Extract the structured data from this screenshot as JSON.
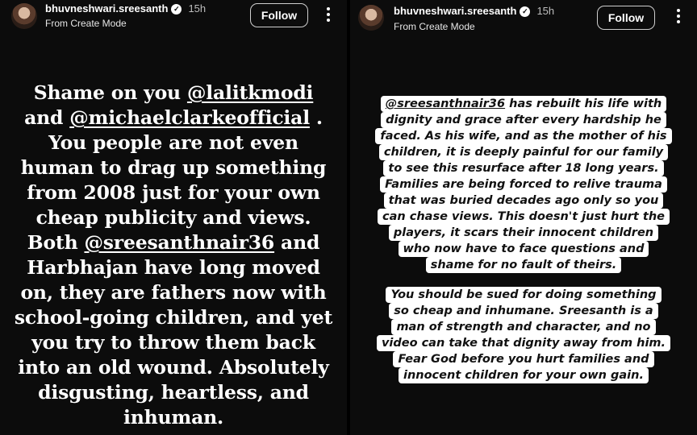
{
  "left": {
    "username": "bhuvneshwari.sreesanth",
    "time": "15h",
    "subtitle": "From Create Mode",
    "follow_label": "Follow",
    "story_lines": [
      "Shame on you ",
      "and ",
      "You people are not even",
      "human to drag up something",
      "from 2008 just for your own",
      "cheap publicity and views.",
      "Both ",
      "Harbhajan have long moved",
      "on, they are fathers now with",
      "school-going children, and yet",
      "you try to throw them back",
      "into an old wound. Absolutely",
      "disgusting, heartless, and",
      "inhuman."
    ],
    "mention_1": "@lalitkmodi",
    "mention_2": "@michaelclarkeofficial",
    "mention_2_suffix": " .",
    "mention_3": "@sreesanthnair36",
    "mention_3_suffix": " and"
  },
  "right": {
    "username": "bhuvneshwari.sreesanth",
    "time": "15h",
    "subtitle": "From Create Mode",
    "follow_label": "Follow",
    "mention": "@sreesanthnair36",
    "para1_first_suffix": " has rebuilt his life with",
    "para1_lines": [
      "dignity and grace after every hardship he",
      "faced. As his wife, and as the mother of his",
      "children, it is deeply painful for our family",
      "to see this resurface after 18 long years.",
      "Families are being forced to relive trauma",
      "that was buried decades ago only so you",
      "can chase views. This doesn't just hurt the",
      "players, it scars their innocent children",
      "who now have to face questions and",
      "shame for no fault of theirs."
    ],
    "para2_lines": [
      "You should be sued for doing something",
      "so cheap and inhumane. Sreesanth is a",
      "man of strength and character, and no",
      "video can take that dignity away from him.",
      "Fear God before you hurt families and",
      "innocent children for your own gain."
    ]
  }
}
